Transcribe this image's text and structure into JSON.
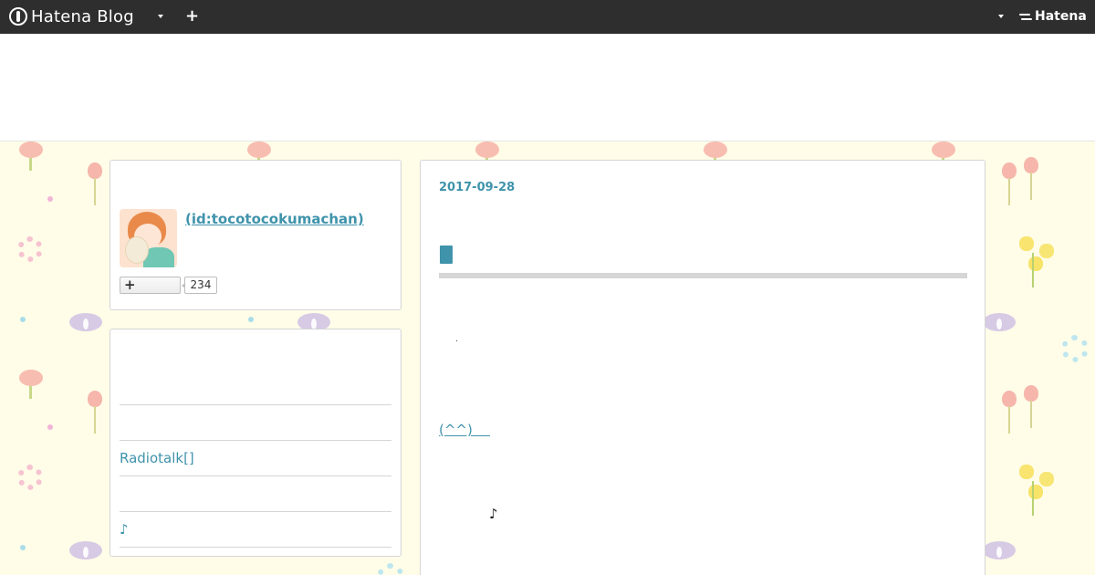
{
  "topbar": {
    "brand": "Hatena Blog",
    "plus_label": "+",
    "right_logo": "Hatena",
    "icons": [
      "hatena-blog-logo-icon",
      "chevron-down-icon",
      "plus-icon",
      "chevron-down-icon",
      "hatena-logo-icon"
    ]
  },
  "profile": {
    "name": " (id:tocotocokumachan)",
    "follow_icon": "+",
    "follower_count": "234"
  },
  "sidebar": {
    "links": [
      "",
      "",
      "Radiotalk[]",
      "",
      "♪"
    ]
  },
  "article": {
    "date": "2017-09-28",
    "tiny_mark": "·",
    "link_text": "(^^)    ",
    "note": "♪"
  },
  "colors": {
    "accent": "#3f93ab",
    "topbar": "#2e2e2e",
    "background": "#fffde8"
  }
}
